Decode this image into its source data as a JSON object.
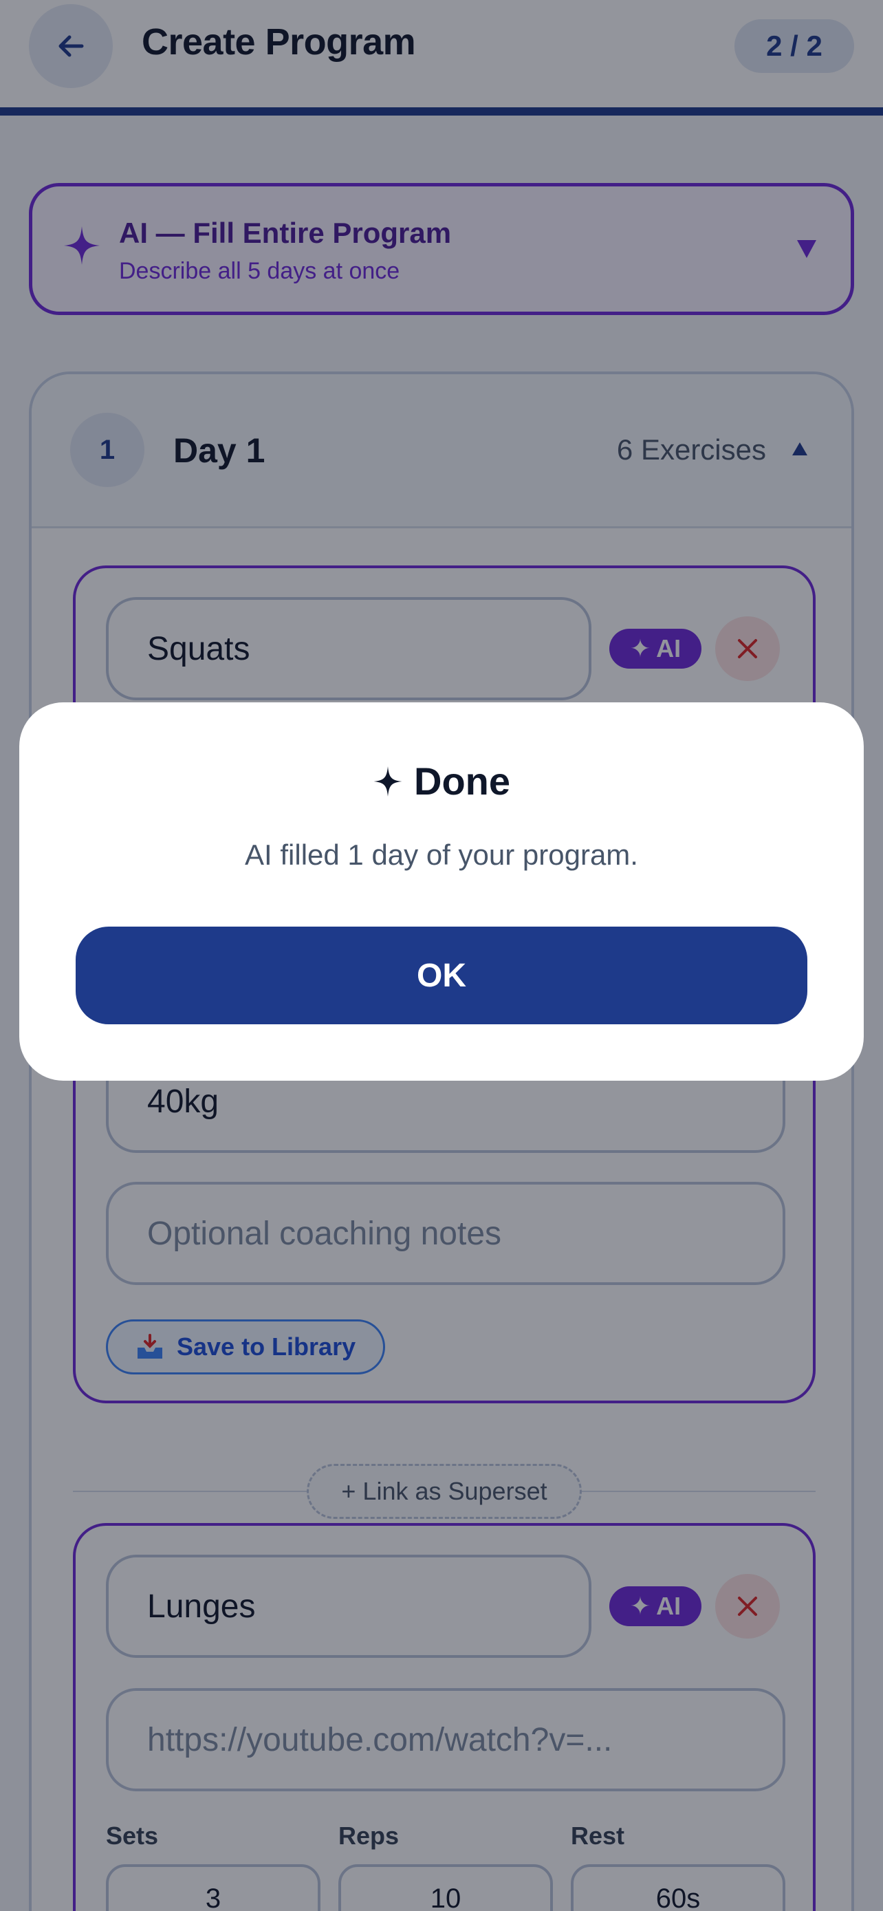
{
  "header": {
    "title": "Create Program",
    "step": "2 / 2"
  },
  "ai_fill": {
    "title": "AI — Fill Entire Program",
    "subtitle": "Describe all 5 days at once"
  },
  "day": {
    "number": "1",
    "title": "Day 1",
    "count": "6 Exercises"
  },
  "exercises": [
    {
      "name": "Squats",
      "ai_label": "AI",
      "weight": "40kg",
      "notes_placeholder": "Optional coaching notes",
      "save_label": "Save to Library"
    },
    {
      "name": "Lunges",
      "ai_label": "AI",
      "video_placeholder": "https://youtube.com/watch?v=...",
      "labels": {
        "sets": "Sets",
        "reps": "Reps",
        "rest": "Rest"
      },
      "sets": "3",
      "reps": "10",
      "rest": "60s"
    }
  ],
  "superset": {
    "label": "+ Link as Superset"
  },
  "modal": {
    "title": "Done",
    "message": "AI filled 1 day of your program.",
    "ok": "OK"
  },
  "colors": {
    "primary": "#1e3a8a",
    "ai_purple": "#6d28d9",
    "danger": "#dc2626"
  }
}
